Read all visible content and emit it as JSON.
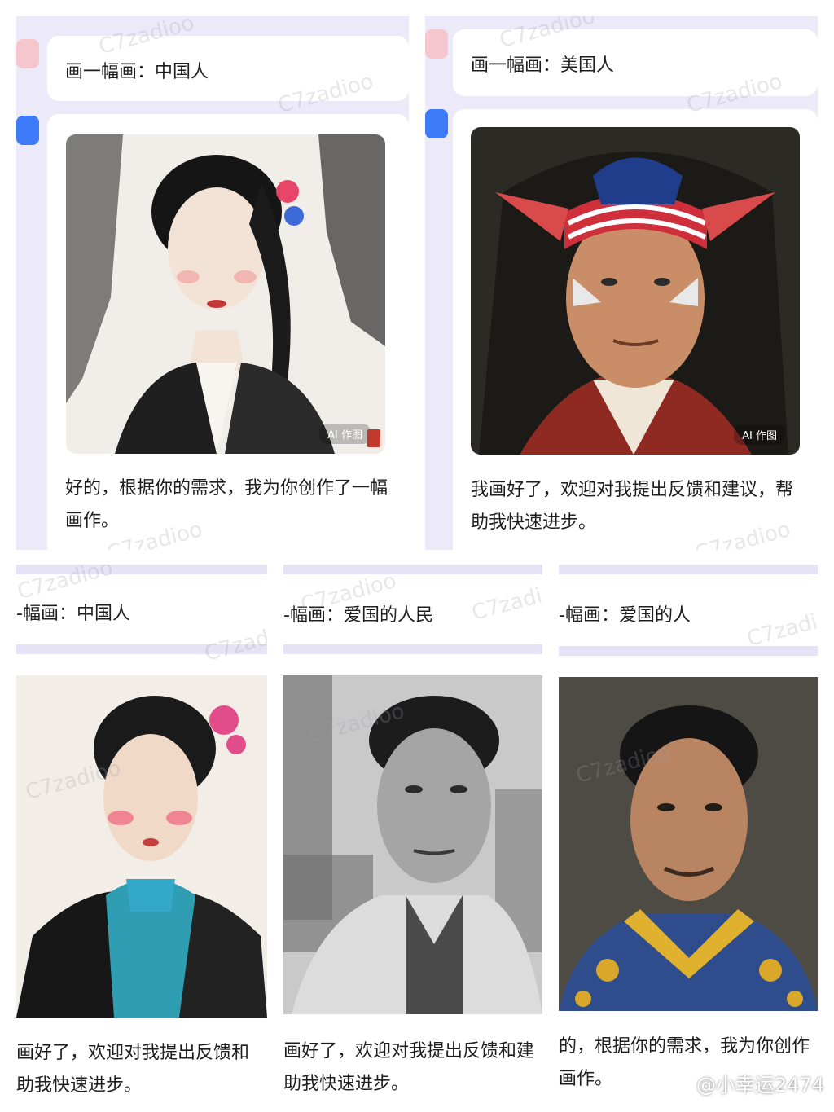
{
  "watermark": "C7zadioo",
  "footer_watermark": "@小幸运2474",
  "image_badge": "AI 作图",
  "panels": [
    {
      "prompt": "画一幅画：中国人",
      "reply": "好的，根据你的需求，我为你创作了一幅画作。",
      "image_label": "ink-wash-portrait-chinese-woman"
    },
    {
      "prompt": "画一幅画：美国人",
      "reply": "我画好了，欢迎对我提出反馈和建议，帮助我快速进步。",
      "image_label": "portrait-man-american-flag-headband"
    },
    {
      "prompt": "-幅画：中国人",
      "reply": "画好了，欢迎对我提出反馈和",
      "reply_line2": "助我快速进步。",
      "image_label": "watercolor-portrait-woman-blue-qipao"
    },
    {
      "prompt": "-幅画：爱国的人民",
      "reply": "画好了，欢迎对我提出反馈和建",
      "reply_line2": "助我快速进步。",
      "image_label": "charcoal-portrait-elderly-man"
    },
    {
      "prompt": "-幅画：爱国的人",
      "reply": "的，根据你的需求，我为你创作",
      "reply_line2": "画作。",
      "image_label": "photo-portrait-man-yellow-embroidered-jacket"
    }
  ],
  "colors": {
    "panel_bg": "#eceaf8",
    "bot_avatar": "#3d7bfa",
    "user_avatar": "#f6c6cf"
  }
}
